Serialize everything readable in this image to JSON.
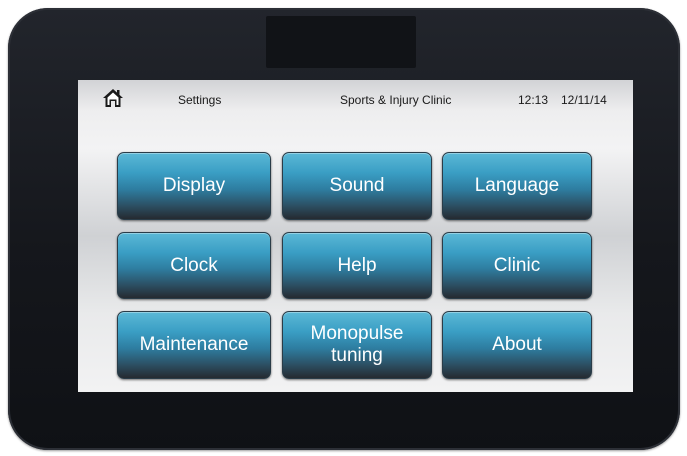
{
  "status_bar": {
    "home_icon": "home-icon",
    "screen_title": "Settings",
    "clinic_name": "Sports & Injury Clinic",
    "time": "12:13",
    "date": "12/11/14"
  },
  "menu": {
    "display": "Display",
    "sound": "Sound",
    "language": "Language",
    "clock": "Clock",
    "help": "Help",
    "clinic": "Clinic",
    "maintenance": "Maintenance",
    "monopulse_tuning": "Monopulse\ntuning",
    "about": "About"
  },
  "colors": {
    "button_top": "#5bb8d6",
    "button_bottom": "#252a30",
    "bezel": "#15171c"
  }
}
